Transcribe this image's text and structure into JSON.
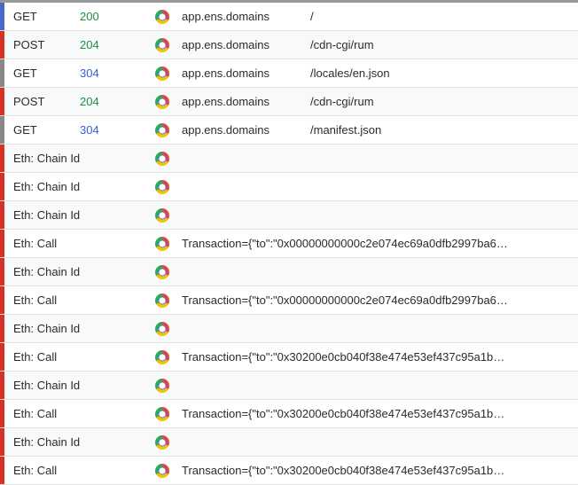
{
  "rows": [
    {
      "marker": "blue",
      "method": "GET",
      "status": "200",
      "statusClass": "s200",
      "domain": "app.ens.domains",
      "path": "/"
    },
    {
      "marker": "red",
      "method": "POST",
      "status": "204",
      "statusClass": "s204",
      "domain": "app.ens.domains",
      "path": "/cdn-cgi/rum"
    },
    {
      "marker": "gray",
      "method": "GET",
      "status": "304",
      "statusClass": "s304",
      "domain": "app.ens.domains",
      "path": "/locales/en.json"
    },
    {
      "marker": "red",
      "method": "POST",
      "status": "204",
      "statusClass": "s204",
      "domain": "app.ens.domains",
      "path": "/cdn-cgi/rum"
    },
    {
      "marker": "gray",
      "method": "GET",
      "status": "304",
      "statusClass": "s304",
      "domain": "app.ens.domains",
      "path": "/manifest.json"
    },
    {
      "marker": "red",
      "method": "Eth: Chain Id",
      "wide": true,
      "path": ""
    },
    {
      "marker": "red",
      "method": "Eth: Chain Id",
      "wide": true,
      "path": ""
    },
    {
      "marker": "red",
      "method": "Eth: Chain Id",
      "wide": true,
      "path": ""
    },
    {
      "marker": "red",
      "method": "Eth: Call",
      "wide": true,
      "path": "Transaction={\"to\":\"0x00000000000c2e074ec69a0dfb2997ba6…"
    },
    {
      "marker": "red",
      "method": "Eth: Chain Id",
      "wide": true,
      "path": ""
    },
    {
      "marker": "red",
      "method": "Eth: Call",
      "wide": true,
      "path": "Transaction={\"to\":\"0x00000000000c2e074ec69a0dfb2997ba6…"
    },
    {
      "marker": "red",
      "method": "Eth: Chain Id",
      "wide": true,
      "path": ""
    },
    {
      "marker": "red",
      "method": "Eth: Call",
      "wide": true,
      "path": "Transaction={\"to\":\"0x30200e0cb040f38e474e53ef437c95a1b…"
    },
    {
      "marker": "red",
      "method": "Eth: Chain Id",
      "wide": true,
      "path": ""
    },
    {
      "marker": "red",
      "method": "Eth: Call",
      "wide": true,
      "path": "Transaction={\"to\":\"0x30200e0cb040f38e474e53ef437c95a1b…"
    },
    {
      "marker": "red",
      "method": "Eth: Chain Id",
      "wide": true,
      "path": ""
    },
    {
      "marker": "red",
      "method": "Eth: Call",
      "wide": true,
      "path": "Transaction={\"to\":\"0x30200e0cb040f38e474e53ef437c95a1b…"
    }
  ]
}
